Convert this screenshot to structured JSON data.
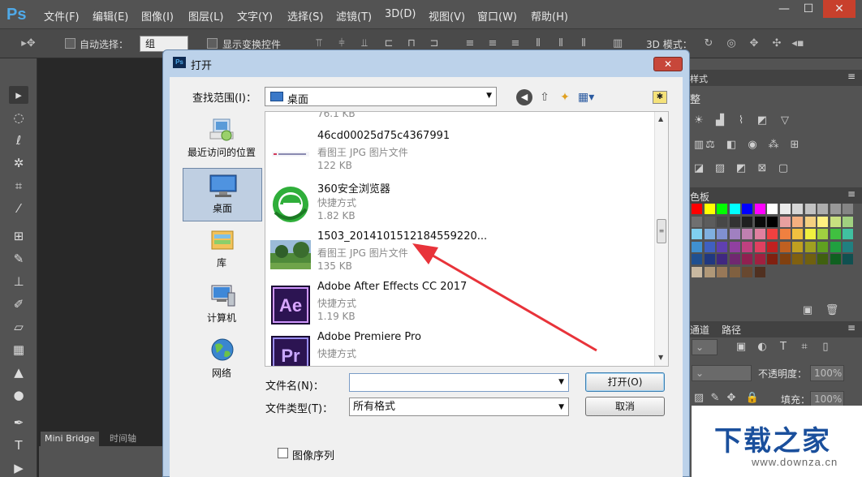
{
  "app": {
    "logo": "Ps",
    "menu": [
      "文件(F)",
      "编辑(E)",
      "图像(I)",
      "图层(L)",
      "文字(Y)",
      "选择(S)",
      "滤镜(T)",
      "3D(D)",
      "视图(V)",
      "窗口(W)",
      "帮助(H)"
    ],
    "window_controls": {
      "minimize": "—",
      "maximize": "☐",
      "close": "✕"
    }
  },
  "options_bar": {
    "auto_select_label": "自动选择：",
    "auto_select_value": "组",
    "show_transform_label": "显示变换控件",
    "mode_3d_label": "3D 模式："
  },
  "bottom_tabs": [
    "Mini Bridge",
    "时间轴"
  ],
  "right_panel": {
    "adjust_tab_partial": "样式",
    "adjust_title_partial": "整",
    "swatches_tab_partial": "色板",
    "channels_tab_partial": "通道",
    "paths_tab": "路径",
    "opacity_label": "不透明度：",
    "opacity_value": "100%",
    "fill_label": "填充：",
    "fill_value": "100%"
  },
  "dialog": {
    "title": "打开",
    "close_label": "✕",
    "look_in_label": "查找范围(I)：",
    "look_in_value": "桌面",
    "places": [
      {
        "label": "最近访问的位置"
      },
      {
        "label": "桌面"
      },
      {
        "label": "库"
      },
      {
        "label": "计算机"
      },
      {
        "label": "网络"
      }
    ],
    "top_cut_size": "76.1 KB",
    "files": [
      {
        "name": "46cd00025d75c4367991",
        "type": "看图王 JPG 图片文件",
        "size": "122 KB"
      },
      {
        "name": "360安全浏览器",
        "type": "快捷方式",
        "size": "1.82 KB"
      },
      {
        "name": "1503_2014101512184559220...",
        "type": "看图王 JPG 图片文件",
        "size": "135 KB"
      },
      {
        "name": "Adobe After Effects CC 2017",
        "type": "快捷方式",
        "size": "1.19 KB"
      },
      {
        "name": "Adobe Premiere Pro",
        "type": "快捷方式",
        "size": ""
      }
    ],
    "file_name_label": "文件名(N)：",
    "file_name_value": "",
    "file_type_label": "文件类型(T)：",
    "file_type_value": "所有格式",
    "open_button": "打开(O)",
    "cancel_button": "取消",
    "image_sequence_label": "图像序列"
  },
  "watermark": {
    "main": "下载之家",
    "sub": "www.downza.cn"
  },
  "colors": {
    "ps_dark": "#535353",
    "dialog_frame": "#bcd2ea",
    "arrow": "#e8333a",
    "watermark_blue": "#1a4f9c"
  }
}
